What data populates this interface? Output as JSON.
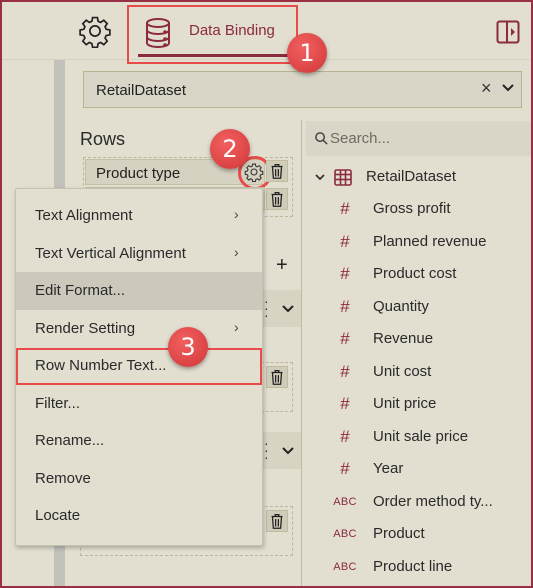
{
  "header": {
    "settings_icon": "gear-icon",
    "tab_label": "Data Binding",
    "tab_icon": "database-icon",
    "panel_toggle_icon": "panel-toggle-icon"
  },
  "callouts": [
    "1",
    "2",
    "3"
  ],
  "dataset_select": {
    "value": "RetailDataset",
    "clear_glyph": "×"
  },
  "rows": {
    "title": "Rows",
    "fields": [
      {
        "label": "Product type"
      },
      {
        "label": ""
      }
    ]
  },
  "context_menu": {
    "items": [
      {
        "label": "Text Alignment",
        "submenu": true
      },
      {
        "label": "Text Vertical Alignment",
        "submenu": true
      },
      {
        "label": "Edit Format...",
        "submenu": false,
        "hovered": true
      },
      {
        "label": "Render Setting",
        "submenu": true
      },
      {
        "label": "Row Number Text...",
        "submenu": false,
        "highlighted": true
      },
      {
        "label": "Filter...",
        "submenu": false
      },
      {
        "label": "Rename...",
        "submenu": false
      },
      {
        "label": "Remove",
        "submenu": false
      },
      {
        "label": "Locate",
        "submenu": false
      }
    ],
    "arrow_glyph": "›"
  },
  "field_list": {
    "search_placeholder": "Search...",
    "dataset": "RetailDataset",
    "fields": [
      {
        "type": "#",
        "label": "Gross profit"
      },
      {
        "type": "#",
        "label": "Planned revenue"
      },
      {
        "type": "#",
        "label": "Product cost"
      },
      {
        "type": "#",
        "label": "Quantity"
      },
      {
        "type": "#",
        "label": "Revenue"
      },
      {
        "type": "#",
        "label": "Unit cost"
      },
      {
        "type": "#",
        "label": "Unit price"
      },
      {
        "type": "#",
        "label": "Unit sale price"
      },
      {
        "type": "#",
        "label": "Year"
      },
      {
        "type": "ABC",
        "label": "Order method ty..."
      },
      {
        "type": "ABC",
        "label": "Product"
      },
      {
        "type": "ABC",
        "label": "Product line"
      }
    ]
  },
  "colors": {
    "accent": "#8c2a3e",
    "highlight": "#e94b4b",
    "background": "#e2ded0"
  }
}
